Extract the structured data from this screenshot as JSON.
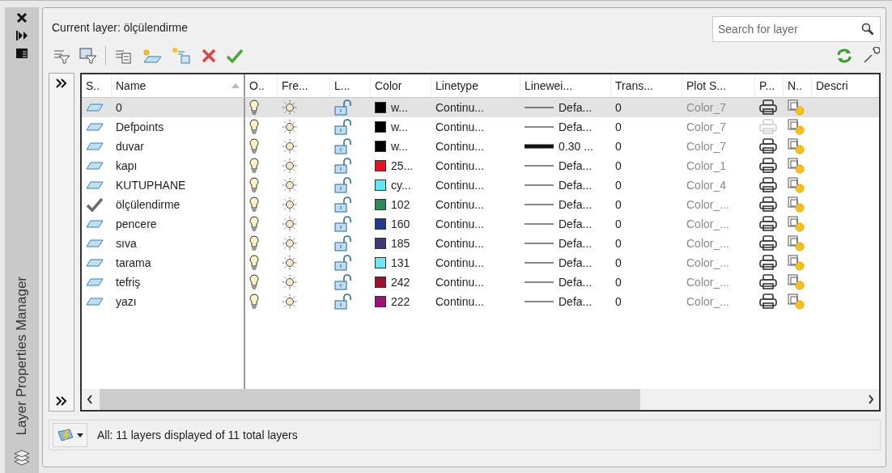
{
  "side_panel": {
    "title": "Layer Properties Manager"
  },
  "header": {
    "current_layer": "Current layer: ölçülendirme",
    "search": {
      "placeholder": "Search for layer"
    }
  },
  "table": {
    "columns": [
      {
        "label": "S..",
        "sorted": false
      },
      {
        "label": "Name",
        "sorted": true
      },
      {
        "label": "O..",
        "sorted": false
      },
      {
        "label": "Fre...",
        "sorted": false
      },
      {
        "label": "L...",
        "sorted": false
      },
      {
        "label": "Color",
        "sorted": false
      },
      {
        "label": "Linetype",
        "sorted": false
      },
      {
        "label": "Linewei...",
        "sorted": false
      },
      {
        "label": "Trans...",
        "sorted": false
      },
      {
        "label": "Plot S...",
        "sorted": false
      },
      {
        "label": "P...",
        "sorted": false
      },
      {
        "label": "N..",
        "sorted": false
      },
      {
        "label": "Descri",
        "sorted": false
      }
    ],
    "rows": [
      {
        "name": "0",
        "selected": true,
        "current": false,
        "on": true,
        "frozen": false,
        "locked": false,
        "color": "#000000",
        "color_label": "w...",
        "linetype": "Continu...",
        "lineweight_heavy": false,
        "lineweight": "Defa...",
        "transparency": "0",
        "plot_style": "Color_7",
        "plot": true
      },
      {
        "name": "Defpoints",
        "selected": false,
        "current": false,
        "on": true,
        "frozen": false,
        "locked": false,
        "color": "#000000",
        "color_label": "w...",
        "linetype": "Continu...",
        "lineweight_heavy": false,
        "lineweight": "Defa...",
        "transparency": "0",
        "plot_style": "Color_7",
        "plot": false
      },
      {
        "name": "duvar",
        "selected": false,
        "current": false,
        "on": true,
        "frozen": false,
        "locked": false,
        "color": "#000000",
        "color_label": "w...",
        "linetype": "Continu...",
        "lineweight_heavy": true,
        "lineweight": "0.30 ...",
        "transparency": "0",
        "plot_style": "Color_7",
        "plot": true
      },
      {
        "name": "kapı",
        "selected": false,
        "current": false,
        "on": true,
        "frozen": false,
        "locked": false,
        "color": "#e3141e",
        "color_label": "25...",
        "linetype": "Continu...",
        "lineweight_heavy": false,
        "lineweight": "Defa...",
        "transparency": "0",
        "plot_style": "Color_1",
        "plot": true
      },
      {
        "name": "KUTUPHANE",
        "selected": false,
        "current": false,
        "on": true,
        "frozen": false,
        "locked": false,
        "color": "#5fe8ef",
        "color_label": "cy...",
        "linetype": "Continu...",
        "lineweight_heavy": false,
        "lineweight": "Defa...",
        "transparency": "0",
        "plot_style": "Color_4",
        "plot": true
      },
      {
        "name": "ölçülendirme",
        "selected": false,
        "current": true,
        "on": true,
        "frozen": false,
        "locked": false,
        "color": "#2f8a55",
        "color_label": "102",
        "linetype": "Continu...",
        "lineweight_heavy": false,
        "lineweight": "Defa...",
        "transparency": "0",
        "plot_style": "Color_...",
        "plot": true
      },
      {
        "name": "pencere",
        "selected": false,
        "current": false,
        "on": true,
        "frozen": false,
        "locked": false,
        "color": "#1f3a8e",
        "color_label": "160",
        "linetype": "Continu...",
        "lineweight_heavy": false,
        "lineweight": "Defa...",
        "transparency": "0",
        "plot_style": "Color_...",
        "plot": true
      },
      {
        "name": "sıva",
        "selected": false,
        "current": false,
        "on": true,
        "frozen": false,
        "locked": false,
        "color": "#3e3a78",
        "color_label": "185",
        "linetype": "Continu...",
        "lineweight_heavy": false,
        "lineweight": "Defa...",
        "transparency": "0",
        "plot_style": "Color_...",
        "plot": true
      },
      {
        "name": "tarama",
        "selected": false,
        "current": false,
        "on": true,
        "frozen": false,
        "locked": false,
        "color": "#6fe6ee",
        "color_label": "131",
        "linetype": "Continu...",
        "lineweight_heavy": false,
        "lineweight": "Defa...",
        "transparency": "0",
        "plot_style": "Color_...",
        "plot": true
      },
      {
        "name": "tefriş",
        "selected": false,
        "current": false,
        "on": true,
        "frozen": false,
        "locked": false,
        "color": "#a0102a",
        "color_label": "242",
        "linetype": "Continu...",
        "lineweight_heavy": false,
        "lineweight": "Defa...",
        "transparency": "0",
        "plot_style": "Color_...",
        "plot": true
      },
      {
        "name": "yazı",
        "selected": false,
        "current": false,
        "on": true,
        "frozen": false,
        "locked": false,
        "color": "#9e107a",
        "color_label": "222",
        "linetype": "Continu...",
        "lineweight_heavy": false,
        "lineweight": "Defa...",
        "transparency": "0",
        "plot_style": "Color_...",
        "plot": true
      }
    ]
  },
  "status_bar": {
    "text": "All: 11 layers displayed of 11 total layers"
  }
}
